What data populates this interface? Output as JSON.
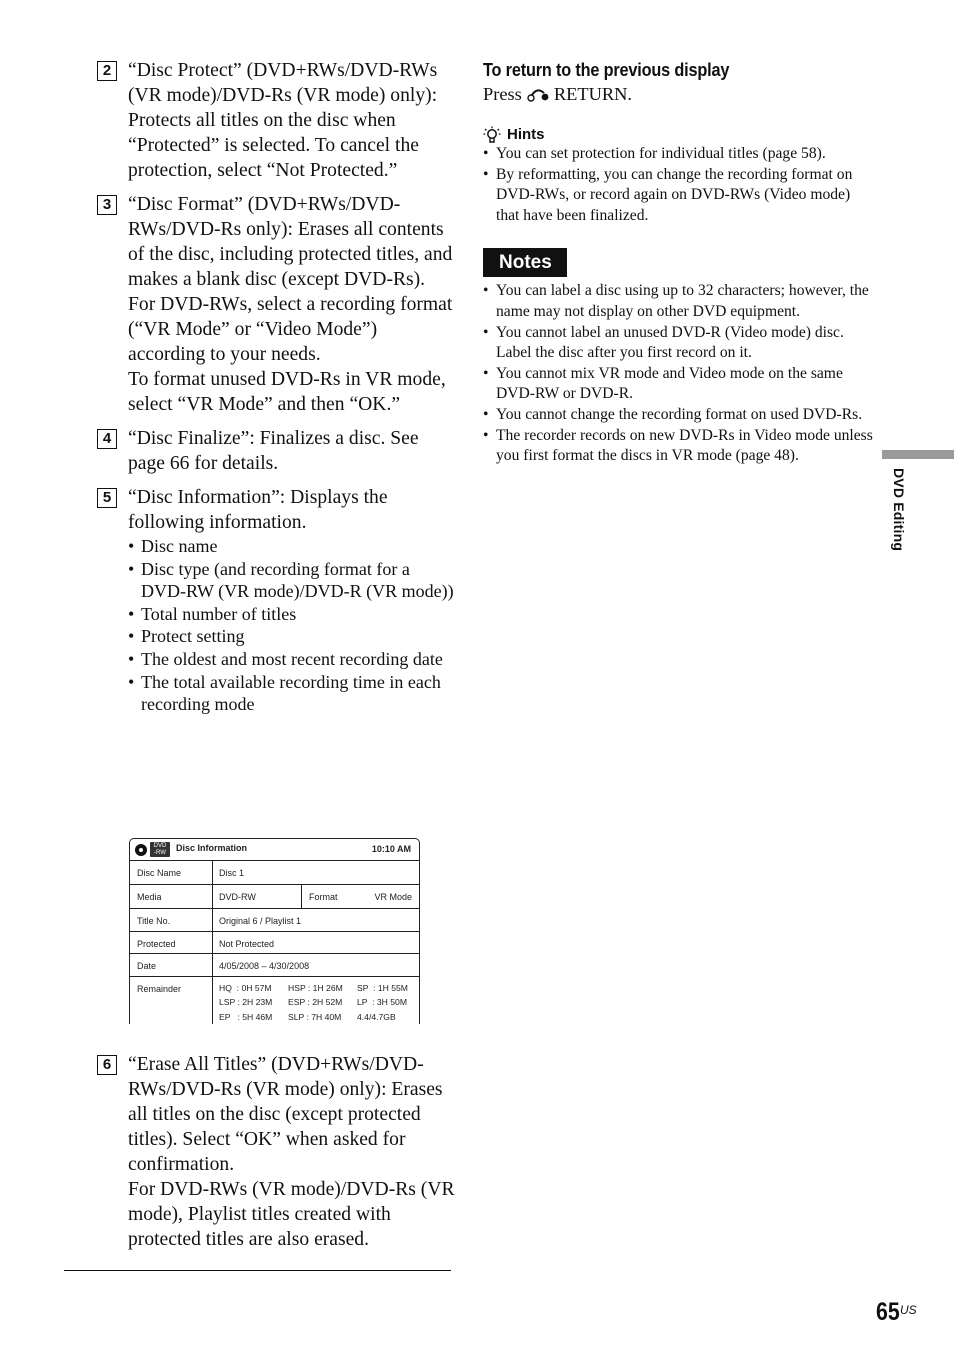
{
  "steps": [
    {
      "num": "2",
      "paragraphs": [
        "“Disc Protect” (DVD+RWs/DVD-RWs (VR mode)/DVD-Rs (VR mode) only): Protects all titles on the disc when “Protected” is selected. To cancel the protection, select “Not Protected.”"
      ]
    },
    {
      "num": "3",
      "paragraphs": [
        "“Disc Format” (DVD+RWs/DVD-RWs/DVD-Rs only): Erases all contents of the disc, including protected titles, and makes a blank disc (except DVD-Rs).",
        "For DVD-RWs, select a recording format (“VR Mode” or “Video Mode”) according to your needs.",
        "To format unused DVD-Rs in VR mode, select “VR Mode” and then “OK.”"
      ]
    },
    {
      "num": "4",
      "paragraphs": [
        "“Disc Finalize”: Finalizes a disc. See page 66 for details."
      ]
    },
    {
      "num": "5",
      "paragraphs": [
        "“Disc Information”: Displays the following information."
      ],
      "bullets": [
        "Disc name",
        "Disc type (and recording format for a DVD-RW (VR mode)/DVD-R (VR mode))",
        "Total number of titles",
        "Protect setting",
        "The oldest and most recent recording date",
        "The total available recording time in each recording mode"
      ]
    },
    {
      "num": "6",
      "paragraphs": [
        "“Erase All Titles” (DVD+RWs/DVD-RWs/DVD-Rs (VR mode) only): Erases all titles on the disc (except protected titles). Select “OK” when asked for confirmation.",
        "For DVD-RWs (VR mode)/DVD-Rs (VR mode), Playlist titles created with protected titles are also erased."
      ]
    }
  ],
  "disc_info_screen": {
    "media_badge_top": "DVD",
    "media_badge_bottom": "-RW",
    "title": "Disc Information",
    "time": "10:10 AM",
    "rows": {
      "disc_name": {
        "label": "Disc Name",
        "value": "Disc 1"
      },
      "media": {
        "label": "Media",
        "value": "DVD-RW",
        "format_label": "Format",
        "format_value": "VR Mode"
      },
      "title_no": {
        "label": "Title No.",
        "value": "Original 6 / Playlist 1"
      },
      "protected": {
        "label": "Protected",
        "value": "Not Protected"
      },
      "date": {
        "label": "Date",
        "value": "4/05/2008 – 4/30/2008"
      },
      "remainder": {
        "label": "Remainder",
        "values": [
          [
            "HQ  : 0H 57M",
            "HSP : 1H 26M",
            "SP  : 1H 55M"
          ],
          [
            "LSP : 2H 23M",
            "ESP : 2H 52M",
            "LP  : 3H 50M"
          ],
          [
            "EP   : 5H 46M",
            "SLP : 7H 40M",
            "4.4/4.7GB"
          ]
        ]
      }
    }
  },
  "right": {
    "heading": "To return to the previous display",
    "press_prefix": "Press",
    "press_suffix": "RETURN.",
    "hints_title": "Hints",
    "hints": [
      "You can set protection for individual titles (page 58).",
      "By reformatting, you can change the recording format on DVD-RWs, or record again on DVD-RWs (Video mode) that have been finalized."
    ],
    "notes_title": "Notes",
    "notes": [
      "You can label a disc using up to 32 characters; however, the name may not display on other DVD equipment.",
      "You cannot label an unused DVD-R (Video mode) disc. Label the disc after you first record on it.",
      "You cannot mix VR mode and Video mode on the same DVD-RW or DVD-R.",
      "You cannot change the recording format on used DVD-Rs.",
      "The recorder records on new DVD-Rs in Video mode unless you first format the discs in VR mode (page 48)."
    ]
  },
  "side_tab": "DVD Editing",
  "page": {
    "number": "65",
    "suffix": "US"
  }
}
